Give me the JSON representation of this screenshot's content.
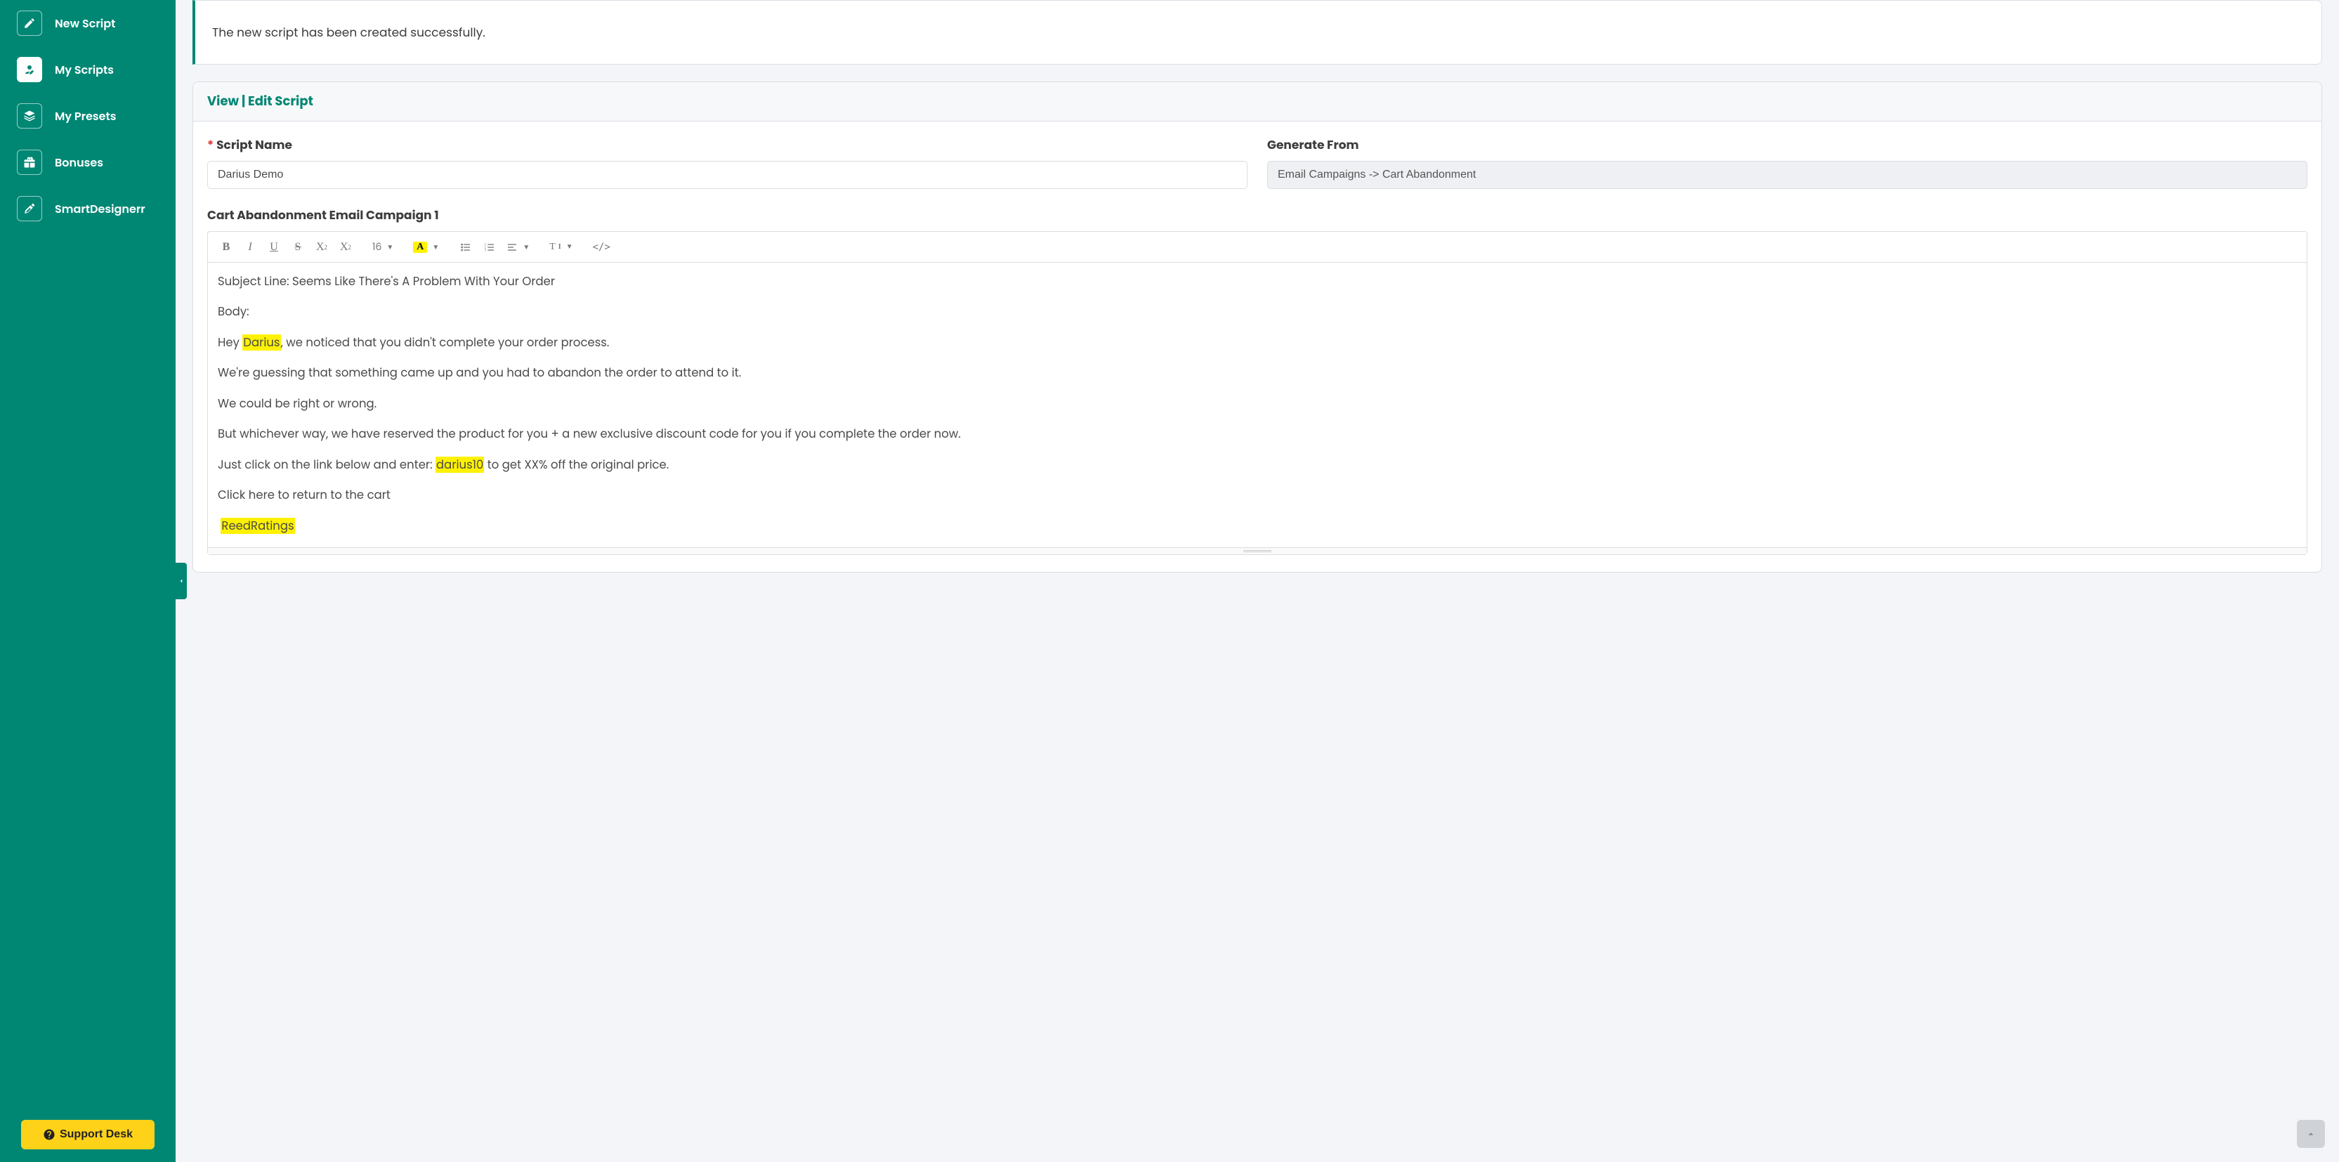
{
  "sidebar": {
    "items": [
      {
        "label": "New Script"
      },
      {
        "label": "My Scripts"
      },
      {
        "label": "My Presets"
      },
      {
        "label": "Bonuses"
      },
      {
        "label": "SmartDesignerr"
      }
    ],
    "active_index": 1,
    "support_label": "Support Desk"
  },
  "alert": {
    "message": "The new script has been created successfully."
  },
  "card": {
    "header": "View | Edit Script",
    "fields": {
      "script_name_label": "Script Name",
      "script_name_value": "Darius Demo",
      "generate_from_label": "Generate From",
      "generate_from_value": "Email Campaigns -> Cart Abandonment"
    }
  },
  "editor": {
    "section_title": "Cart Abandonment Email Campaign 1",
    "font_size": "16",
    "body": {
      "l1": "Subject Line: Seems Like There's A Problem With Your Order",
      "l2": "Body:",
      "l3a": "Hey ",
      "l3h": "Darius",
      "l3b": ", we noticed that you didn't complete your order process.",
      "l4": "We're guessing that something came up and you had to abandon the order to attend to it.",
      "l5": "We could be right or wrong.",
      "l6": "But whichever way, we have reserved the product for you + a new exclusive discount code for you if you complete the order now.",
      "l7a": "Just click on the link below and enter: ",
      "l7h": "darius10",
      "l7b": " to get XX% off the original price.",
      "l8": "Click here to return to the cart",
      "l9h": "ReedRatings"
    }
  }
}
